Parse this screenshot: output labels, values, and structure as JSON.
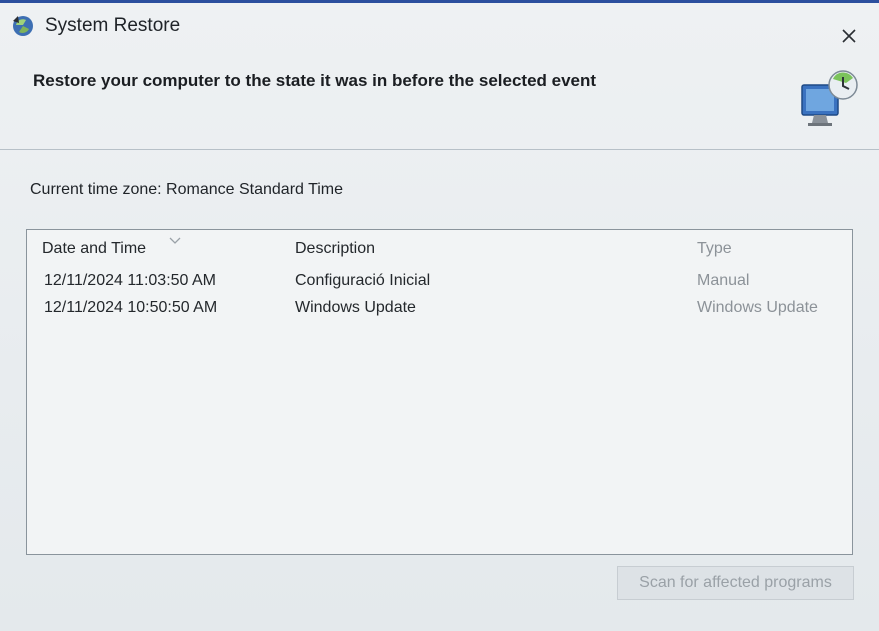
{
  "window": {
    "title": "System Restore",
    "title_icon": "system-restore-icon",
    "close_icon": "close-icon"
  },
  "header": {
    "instruction": "Restore your computer to the state it was in before the selected event",
    "icon": "monitor-restore-icon"
  },
  "timezone_label": "Current time zone: Romance Standard Time",
  "restore_points": {
    "columns": [
      {
        "label": "Date and Time",
        "sorted": "descending"
      },
      {
        "label": "Description"
      },
      {
        "label": "Type"
      }
    ],
    "rows": [
      {
        "date": "12/11/2024 11:03:50 AM",
        "description": "Configuració Inicial",
        "type": "Manual"
      },
      {
        "date": "12/11/2024 10:50:50 AM",
        "description": "Windows Update",
        "type": "Windows Update"
      }
    ]
  },
  "buttons": {
    "scan_label": "Scan for affected programs",
    "scan_enabled": false
  },
  "colors": {
    "title_accent": "#2b4f9e",
    "disabled_text": "#9aa1a7"
  }
}
